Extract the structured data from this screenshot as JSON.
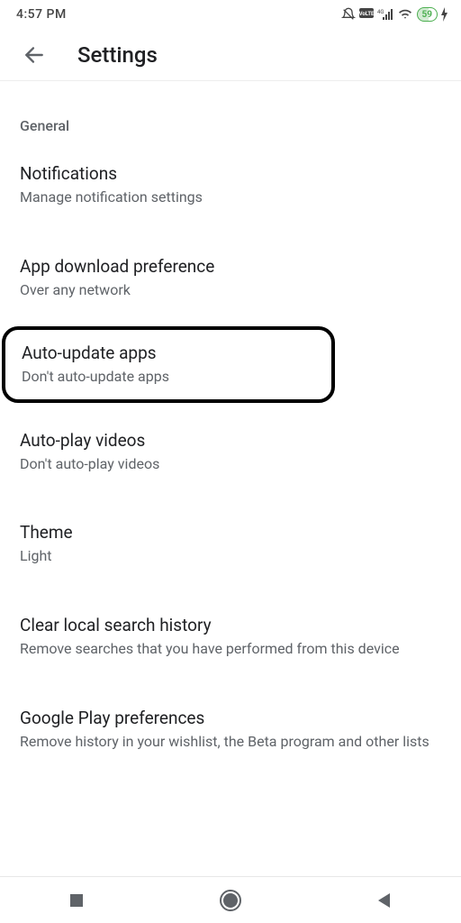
{
  "status": {
    "time": "4:57 PM",
    "battery": "59"
  },
  "header": {
    "title": "Settings"
  },
  "section": {
    "header": "General"
  },
  "settings": {
    "notifications": {
      "title": "Notifications",
      "subtitle": "Manage notification settings"
    },
    "download_pref": {
      "title": "App download preference",
      "subtitle": "Over any network"
    },
    "auto_update": {
      "title": "Auto-update apps",
      "subtitle": "Don't auto-update apps"
    },
    "auto_play": {
      "title": "Auto-play videos",
      "subtitle": "Don't auto-play videos"
    },
    "theme": {
      "title": "Theme",
      "subtitle": "Light"
    },
    "clear_search": {
      "title": "Clear local search history",
      "subtitle": "Remove searches that you have performed from this device"
    },
    "play_prefs": {
      "title": "Google Play preferences",
      "subtitle": "Remove history in your wishlist, the Beta program and other lists"
    }
  }
}
